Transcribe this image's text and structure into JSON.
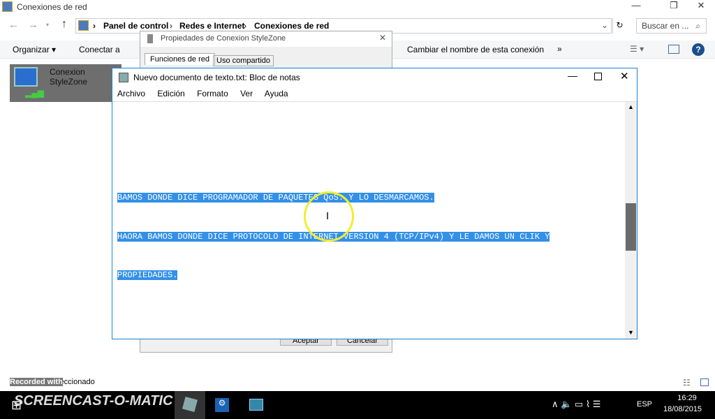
{
  "explorer": {
    "title": "Conexiones de red",
    "breadcrumb": [
      "Panel de control",
      "Redes e Internet",
      "Conexiones de red"
    ],
    "search_placeholder": "Buscar en ...",
    "toolbar": {
      "organize": "Organizar",
      "connect": "Conectar a",
      "rename": "Cambiar el nombre de esta conexión",
      "more": "»"
    },
    "item": {
      "name": "Conexion StyleZone"
    },
    "status": "2 elemento seleccionado"
  },
  "dialog": {
    "title": "Propiedades de Conexion StyleZone",
    "tabs": [
      "Funciones de red",
      "Uso compartido"
    ],
    "ok": "Aceptar",
    "cancel": "Cancelar"
  },
  "notepad": {
    "title": "Nuevo documento de texto.txt: Bloc de notas",
    "menu": [
      "Archivo",
      "Edición",
      "Formato",
      "Ver",
      "Ayuda"
    ],
    "lines": [
      "BAMOS DONDE DICE PROGRAMADOR DE PAQUETES QoS. Y LO DESMARCAMOS.",
      "HAORA BAMOS DONDE DICE PROTOCOLO DE INTERNET VERSION 4 (TCP/IPv4) Y LE DAMOS UN CLIK Y",
      "PROPIEDADES."
    ]
  },
  "watermark": {
    "recorded": "Recorded with",
    "brand": "SCREENCAST-O-MATIC"
  },
  "taskbar": {
    "lang": "ESP",
    "time": "16:29",
    "date": "18/08/2015"
  }
}
